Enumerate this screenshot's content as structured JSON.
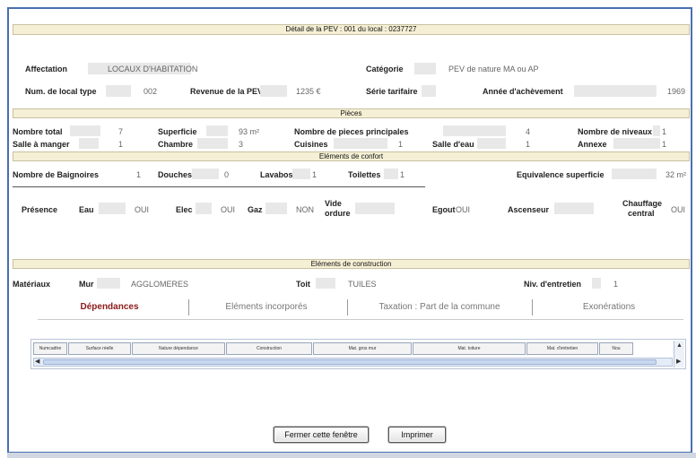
{
  "header": {
    "title": "Détail de la PEV : 001 du local : 0237727"
  },
  "affectation": {
    "label": "Affectation",
    "value": "LOCAUX D'HABITATION"
  },
  "categorie": {
    "label": "Catégorie",
    "value": "PEV de nature MA ou AP"
  },
  "num_local_type": {
    "label": "Num. de local type",
    "value": "002"
  },
  "revenu": {
    "label": "Revenue de la PEV",
    "value": "1235 €"
  },
  "serie_tarifaire": {
    "label": "Série tarifaire",
    "value": ""
  },
  "annee_achevement": {
    "label": "Année d'achèvement",
    "value": "1969"
  },
  "sections": {
    "pieces": "Pièces",
    "confort": "Eléments de confort",
    "construction": "Eléments de construction"
  },
  "pieces": {
    "nombre_total": {
      "label": "Nombre total",
      "value": "7"
    },
    "superficie": {
      "label": "Superficie",
      "value": "93 m²"
    },
    "pieces_principales": {
      "label": "Nombre de pieces principales",
      "value": "4"
    },
    "niveaux": {
      "label": "Nombre de niveaux",
      "value": "1"
    },
    "salle_a_manger": {
      "label": "Salle à manger",
      "value": "1"
    },
    "chambre": {
      "label": "Chambre",
      "value": "3"
    },
    "cuisines": {
      "label": "Cuisines",
      "value": "1"
    },
    "salle_eau": {
      "label": "Salle d'eau",
      "value": "1"
    },
    "annexe": {
      "label": "Annexe",
      "value": "1"
    }
  },
  "confort": {
    "baignoires": {
      "label": "Nombre de Baignoires",
      "value": "1"
    },
    "douches": {
      "label": "Douches",
      "value": "0"
    },
    "lavabos": {
      "label": "Lavabos",
      "value": "1"
    },
    "toilettes": {
      "label": "Toilettes",
      "value": "1"
    },
    "equivalence": {
      "label": "Equivalence superficie",
      "value": "32 m²"
    },
    "presence": {
      "label": "Présence"
    },
    "eau": {
      "label": "Eau",
      "value": "OUI"
    },
    "elec": {
      "label": "Elec",
      "value": "OUI"
    },
    "gaz": {
      "label": "Gaz",
      "value": "NON"
    },
    "vide_ordure": {
      "label_1": "Vide",
      "label_2": "ordure",
      "value": ""
    },
    "egout": {
      "label": "Egout",
      "value": "OUI"
    },
    "ascenseur": {
      "label": "Ascenseur",
      "value": ""
    },
    "chauffage": {
      "label_1": "Chauffage",
      "label_2": "central",
      "value": "OUI"
    }
  },
  "construction": {
    "materiaux": {
      "label": "Matériaux"
    },
    "mur": {
      "label": "Mur",
      "value": "AGGLOMERES"
    },
    "toit": {
      "label": "Toit",
      "value": "TUILES"
    },
    "entretien": {
      "label": "Niv. d'entretien",
      "value": "1"
    }
  },
  "tabs": [
    {
      "label": "Dépendances"
    },
    {
      "label": "Eléments incorporés"
    },
    {
      "label": "Taxation : Part de la commune"
    },
    {
      "label": "Exonérations"
    }
  ],
  "grid": {
    "columns": [
      "Numcadtre",
      "Surface réelle",
      "Nature dépendance",
      "Construction",
      "Mat. gros mur",
      "Mat. toiture",
      "Mat. d'entretien",
      "Nou"
    ]
  },
  "buttons": {
    "close": "Fermer cette fenêtre",
    "print": "Imprimer"
  }
}
